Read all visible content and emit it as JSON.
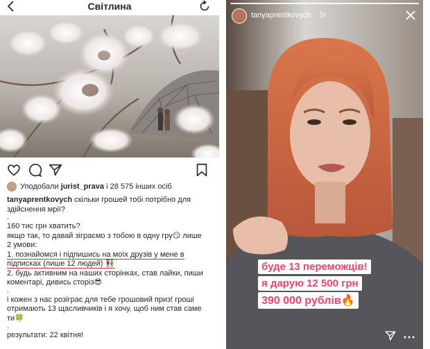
{
  "post": {
    "title": "Світлина",
    "likes": {
      "prefix": "Уподобали",
      "user": "jurist_prava",
      "rest": "і 28 575 інших осіб"
    },
    "caption": {
      "author": "tanyaprentkovych",
      "line1": " скільки грошей тобі потрібно для",
      "line2": "здійснення мрії?",
      "dot1": ".",
      "line3": "160 тис грн хватить?",
      "line4": "якщо так, то давай зіграємо з тобою в одну гру😏 лише",
      "line5": "2 умови:",
      "line6": "1. познайомся і підпишись на моїх друзів у мене в",
      "line7": "підписках (лише 12 людей) 👫",
      "line8": "2. будь активним на наших сторінках, став лайки, пиши",
      "line9": "коментарі, дивись сторіз😎",
      "dot2": ".",
      "line10": "і кожен з нас розіграє для тебе грошовий приз! гроші",
      "line11": "отримають 13 щасливчиків і я хочу, щоб ним став саме",
      "line12": "ти🍀",
      "dot3": ".",
      "line13": "результати: 22 квітня!"
    }
  },
  "story": {
    "username": "tanyaprentkovych",
    "time": "5г",
    "stickers": [
      "буде 13 переможців!",
      "я дарую 12 500 грн",
      "390 000 рублів🔥"
    ]
  },
  "icons": {
    "back": "chevron-left-icon",
    "refresh": "refresh-icon",
    "like": "heart-icon",
    "comment": "comment-icon",
    "share": "send-icon",
    "save": "bookmark-icon",
    "close": "close-icon",
    "more": "more-dots-icon"
  },
  "colors": {
    "sticker_text": "#f2436b",
    "underline": "#d0333a",
    "text": "#262626"
  }
}
